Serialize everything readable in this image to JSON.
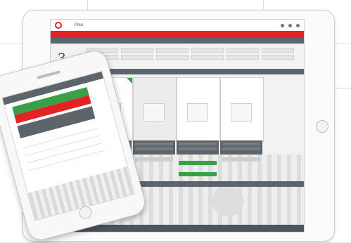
{
  "tablet": {
    "app_title": "Plan",
    "big_number": "3"
  }
}
